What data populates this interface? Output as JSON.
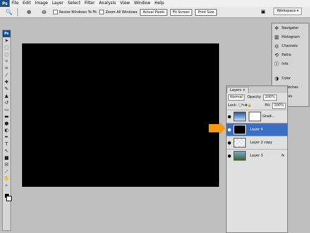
{
  "menubar": {
    "app_badge": "Ps",
    "items": [
      "File",
      "Edit",
      "Image",
      "Layer",
      "Select",
      "Filter",
      "Analysis",
      "View",
      "Window",
      "Help"
    ]
  },
  "options": {
    "zoom_tool_icon": "zoom-icon",
    "checkboxes": [
      {
        "label": "Resize Windows To Fit",
        "checked": false
      },
      {
        "label": "Zoom All Windows",
        "checked": false
      }
    ],
    "buttons": [
      "Actual Pixels",
      "Fit Screen",
      "Print Size"
    ],
    "workspace_label": "Workspace ▾"
  },
  "toolbox": {
    "logo": "Ps",
    "tools": [
      "move",
      "marquee",
      "lasso",
      "magic-wand",
      "crop",
      "slice",
      "healing",
      "brush",
      "stamp",
      "history-brush",
      "eraser",
      "gradient",
      "blur",
      "dodge",
      "pen",
      "type",
      "path-select",
      "shape",
      "notes",
      "eyedropper",
      "hand",
      "zoom"
    ]
  },
  "dock": {
    "items": [
      "Navigator",
      "Histogram",
      "Channels",
      "Paths",
      "Info"
    ],
    "items2": [
      "Color",
      "Swatches",
      "Styles"
    ]
  },
  "layers": {
    "tab": "Layers",
    "blend_mode": "Normal",
    "opacity_label": "Opacity:",
    "opacity": "100%",
    "lock_label": "Lock:",
    "fill_label": "Fill:",
    "fill": "100%",
    "rows": [
      {
        "name": "Gradi...",
        "active": false
      },
      {
        "name": "Layer 4",
        "active": true
      },
      {
        "name": "Layer 2 copy",
        "active": false
      },
      {
        "name": "Layer 3",
        "active": false
      }
    ],
    "fx": "fx"
  },
  "colors": {
    "accent": "#3b6fc4",
    "arrow": "#f39a12"
  }
}
